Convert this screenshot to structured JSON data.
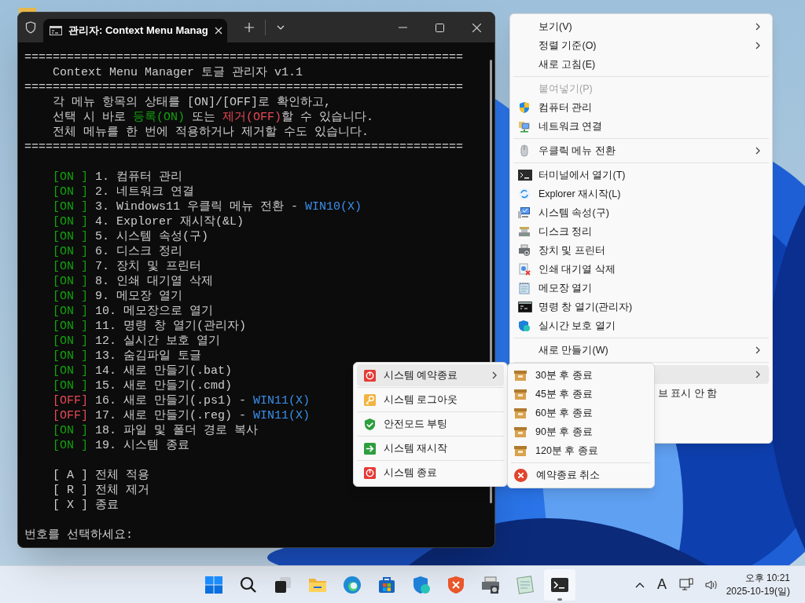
{
  "terminal": {
    "tab_title": "관리자: Context Menu Manag",
    "banner": [
      {
        "kind": "rule",
        "text": "=============================================================="
      },
      {
        "kind": "title",
        "text": "Context Menu Manager 토글 관리자 v1.1"
      },
      {
        "kind": "rule",
        "text": "=============================================================="
      },
      {
        "kind": "intro",
        "segments": [
          {
            "text": "각 메뉴 항목의 상태를 [ON]/[OFF]로 확인하고,",
            "kind": "plain"
          }
        ]
      },
      {
        "kind": "intro",
        "segments": [
          {
            "text": "선택 시 바로 ",
            "kind": "plain"
          },
          {
            "text": "등록(ON)",
            "kind": "on"
          },
          {
            "text": " 또는 ",
            "kind": "plain"
          },
          {
            "text": "제거(OFF)",
            "kind": "off"
          },
          {
            "text": "할 수 있습니다.",
            "kind": "plain"
          }
        ]
      },
      {
        "kind": "intro",
        "segments": [
          {
            "text": "전체 메뉴를 한 번에 적용하거나 제거할 수도 있습니다.",
            "kind": "plain"
          }
        ]
      },
      {
        "kind": "rule",
        "text": "=============================================================="
      }
    ],
    "items": [
      {
        "status": "[ON ]",
        "on": true,
        "label": "1. 컴퓨터 관리"
      },
      {
        "status": "[ON ]",
        "on": true,
        "label": "2. 네트워크 연결"
      },
      {
        "status": "[ON ]",
        "on": true,
        "label": "3. Windows11 우클릭 메뉴 전환 -",
        "note": "WIN10(X)"
      },
      {
        "status": "[ON ]",
        "on": true,
        "label": "4. Explorer 재시작(&L)"
      },
      {
        "status": "[ON ]",
        "on": true,
        "label": "5. 시스템 속성(구)"
      },
      {
        "status": "[ON ]",
        "on": true,
        "label": "6. 디스크 정리"
      },
      {
        "status": "[ON ]",
        "on": true,
        "label": "7. 장치 및 프린터"
      },
      {
        "status": "[ON ]",
        "on": true,
        "label": "8. 인쇄 대기열 삭제"
      },
      {
        "status": "[ON ]",
        "on": true,
        "label": "9. 메모장 열기"
      },
      {
        "status": "[ON ]",
        "on": true,
        "label": "10. 메모장으로 열기"
      },
      {
        "status": "[ON ]",
        "on": true,
        "label": "11. 명령 창 열기(관리자)"
      },
      {
        "status": "[ON ]",
        "on": true,
        "label": "12. 실시간 보호 열기"
      },
      {
        "status": "[ON ]",
        "on": true,
        "label": "13. 숨김파일 토글"
      },
      {
        "status": "[ON ]",
        "on": true,
        "label": "14. 새로 만들기(.bat)"
      },
      {
        "status": "[ON ]",
        "on": true,
        "label": "15. 새로 만들기(.cmd)"
      },
      {
        "status": "[OFF]",
        "on": false,
        "label": "16. 새로 만들기(.ps1) -",
        "note": "WIN11(X)"
      },
      {
        "status": "[OFF]",
        "on": false,
        "label": "17. 새로 만들기(.reg) -",
        "note": "WIN11(X)"
      },
      {
        "status": "[ON ]",
        "on": true,
        "label": "18. 파일 및 폴더 경로 복사"
      },
      {
        "status": "[ON ]",
        "on": true,
        "label": "19. 시스템 종료"
      }
    ],
    "actions": [
      {
        "key": "[ A ]",
        "label": "전체 적용"
      },
      {
        "key": "[ R ]",
        "label": "전체 제거"
      },
      {
        "key": "[ X ]",
        "label": "종료"
      }
    ],
    "prompt": "번호를 선택하세요:"
  },
  "menu": {
    "items": [
      {
        "kind": "item",
        "label": "보기(V)",
        "submenu": true,
        "disabled": false,
        "selected": false
      },
      {
        "kind": "item",
        "label": "정렬 기준(O)",
        "submenu": true,
        "disabled": false,
        "selected": false
      },
      {
        "kind": "item",
        "label": "새로 고침(E)",
        "submenu": false,
        "disabled": false,
        "selected": false
      },
      {
        "kind": "separator"
      },
      {
        "kind": "item",
        "label": "붙여넣기(P)",
        "submenu": false,
        "disabled": true,
        "selected": false
      },
      {
        "kind": "item",
        "label": "컴퓨터 관리",
        "submenu": false,
        "disabled": false,
        "selected": false
      },
      {
        "kind": "item",
        "label": "네트워크 연결",
        "submenu": false,
        "disabled": false,
        "selected": false
      },
      {
        "kind": "separator"
      },
      {
        "kind": "item",
        "label": "우클릭 메뉴 전환",
        "submenu": true,
        "disabled": false,
        "selected": false
      },
      {
        "kind": "separator"
      },
      {
        "kind": "item",
        "label": "터미널에서 열기(T)",
        "submenu": false,
        "disabled": false,
        "selected": false
      },
      {
        "kind": "item",
        "label": "Explorer 재시작(L)",
        "submenu": false,
        "disabled": false,
        "selected": false
      },
      {
        "kind": "item",
        "label": "시스템 속성(구)",
        "submenu": false,
        "disabled": false,
        "selected": false
      },
      {
        "kind": "item",
        "label": "디스크 정리",
        "submenu": false,
        "disabled": false,
        "selected": false
      },
      {
        "kind": "item",
        "label": "장치 및 프린터",
        "submenu": false,
        "disabled": false,
        "selected": false
      },
      {
        "kind": "item",
        "label": "인쇄 대기열 삭제",
        "submenu": false,
        "disabled": false,
        "selected": false
      },
      {
        "kind": "item",
        "label": "메모장 열기",
        "submenu": false,
        "disabled": false,
        "selected": false
      },
      {
        "kind": "item",
        "label": "명령 창 열기(관리자)",
        "submenu": false,
        "disabled": false,
        "selected": false
      },
      {
        "kind": "item",
        "label": "실시간 보호 열기",
        "submenu": false,
        "disabled": false,
        "selected": false
      },
      {
        "kind": "separator"
      },
      {
        "kind": "item",
        "label": "새로 만들기(W)",
        "submenu": true,
        "disabled": false,
        "selected": false
      },
      {
        "kind": "separator"
      },
      {
        "kind": "item",
        "submenu": true,
        "disabled": false,
        "selected": true
      },
      {
        "kind": "item",
        "label": "브 표시 안 함",
        "submenu": false,
        "disabled": false,
        "selected": false
      }
    ]
  },
  "submenu": {
    "items": [
      {
        "label": "시스템 예약종료",
        "submenu": true,
        "selected": true
      },
      {
        "label": "시스템 로그아웃",
        "submenu": false,
        "selected": false
      },
      {
        "label": "안전모드 부팅",
        "submenu": false,
        "selected": false
      },
      {
        "label": "시스템 재시작",
        "submenu": false,
        "selected": false
      },
      {
        "label": "시스템 종료",
        "submenu": false,
        "selected": false
      }
    ]
  },
  "timer_menu": {
    "items": [
      {
        "kind": "timer",
        "label": "30분 후 종료"
      },
      {
        "kind": "timer",
        "label": "45분 후 종료"
      },
      {
        "kind": "timer",
        "label": "60분 후 종료"
      },
      {
        "kind": "timer",
        "label": "90분 후 종료"
      },
      {
        "kind": "timer",
        "label": "120분 후 종료"
      },
      {
        "kind": "cancel",
        "label": "예약종료 취소"
      }
    ]
  },
  "taskbar": {
    "apps": [
      {
        "running": false
      },
      {
        "running": false
      },
      {
        "running": false
      },
      {
        "running": false
      },
      {
        "running": false
      },
      {
        "running": false
      },
      {
        "running": false
      },
      {
        "running": false
      },
      {
        "running": false
      },
      {
        "running": false
      },
      {
        "running": true
      }
    ],
    "input_mode": "A",
    "time": "오후 10:21",
    "date": "2025-10-19(일)"
  }
}
